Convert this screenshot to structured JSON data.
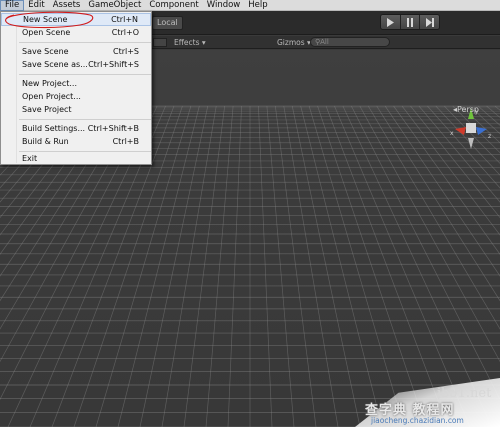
{
  "menubar": {
    "items": [
      "File",
      "Edit",
      "Assets",
      "GameObject",
      "Component",
      "Window",
      "Help"
    ]
  },
  "toolbar": {
    "fragment_label": "Local",
    "play_controls": [
      "play-icon",
      "pause-icon",
      "step-icon"
    ]
  },
  "scene_header": {
    "effects_label": "Effects",
    "gizmos_label": "Gizmos",
    "search_placeholder": "All"
  },
  "viewport": {
    "projection_label": "Persp",
    "gizmo_axes": [
      "y",
      "x",
      "z"
    ],
    "colors": {
      "x": "#d03a2a",
      "y": "#6fc23c",
      "z": "#3a6fd0"
    }
  },
  "file_menu": {
    "items": [
      {
        "label": "New Scene",
        "shortcut": "Ctrl+N"
      },
      {
        "label": "Open Scene",
        "shortcut": "Ctrl+O"
      },
      {
        "label": "Save Scene",
        "shortcut": "Ctrl+S"
      },
      {
        "label": "Save Scene as...",
        "shortcut": "Ctrl+Shift+S"
      },
      {
        "label": "New Project...",
        "shortcut": ""
      },
      {
        "label": "Open Project...",
        "shortcut": ""
      },
      {
        "label": "Save Project",
        "shortcut": ""
      },
      {
        "label": "Build Settings...",
        "shortcut": "Ctrl+Shift+B"
      },
      {
        "label": "Build & Run",
        "shortcut": "Ctrl+B"
      },
      {
        "label": "Exit",
        "shortcut": ""
      }
    ]
  },
  "watermark": {
    "site": "jb51.net",
    "chinese": "查字典 教程网",
    "url": "jiaocheng.chazidian.com"
  }
}
